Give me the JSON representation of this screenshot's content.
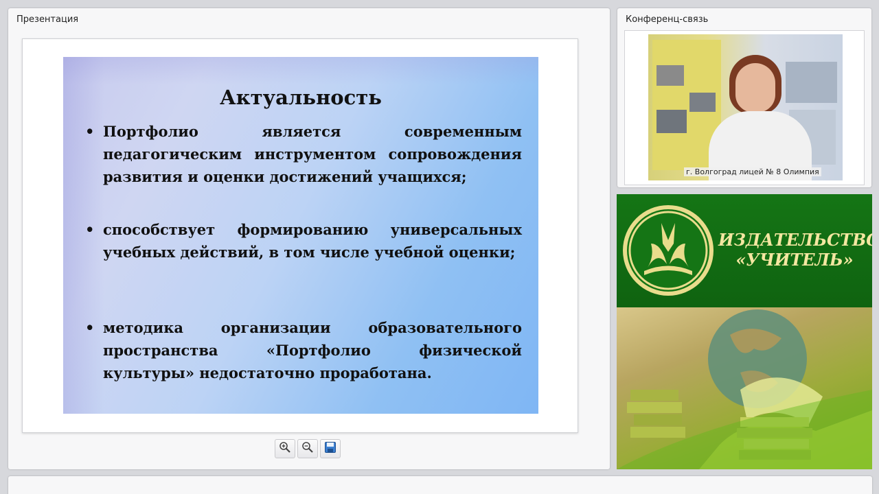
{
  "presentation": {
    "title": "Презентация",
    "slide": {
      "heading": "Актуальность",
      "bullets": [
        "Портфолио является современным педагогическим инструментом сопровождения развития и оценки достижений учащихся;",
        "способствует формированию универсальных учебных действий, в том числе учебной оценки;",
        "методика организации образовательного пространства «Портфолио физической культуры» недостаточно проработана."
      ],
      "bullet_symbol": "•"
    },
    "toolbar": {
      "icons": [
        "zoom-in-icon",
        "zoom-out-icon",
        "save-icon"
      ]
    }
  },
  "conference": {
    "title": "Конференц-связь",
    "caption": "г. Волгоград лицей № 8 Олимпия"
  },
  "publisher": {
    "name_line1": "ИЗДАТЕЛЬСТВО",
    "name_line2": "«УЧИТЕЛЬ»",
    "colors": {
      "background": "#157515",
      "text": "#f4e7a1"
    }
  }
}
